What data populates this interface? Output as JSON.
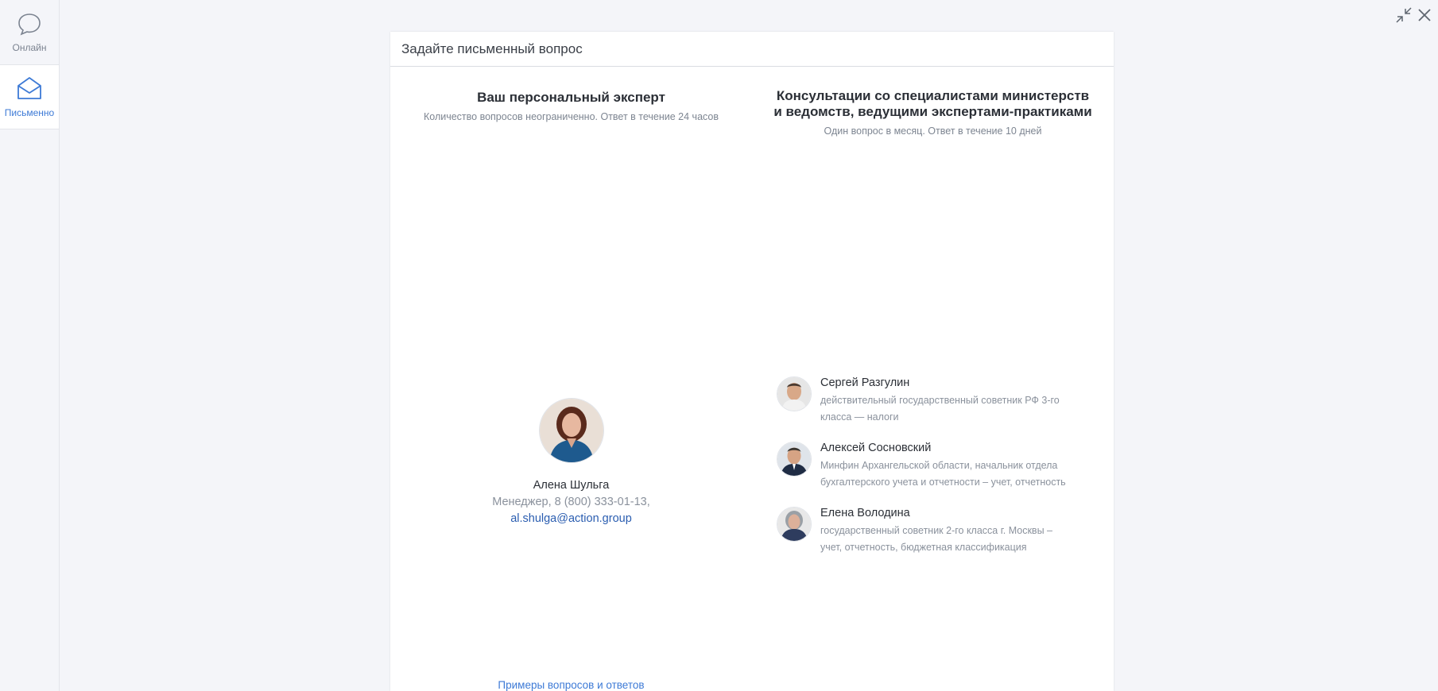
{
  "sidebar": {
    "items": [
      {
        "label": "Онлайн",
        "icon": "chat-bubble-icon",
        "active": false
      },
      {
        "label": "Письменно",
        "icon": "envelope-icon",
        "active": true
      }
    ]
  },
  "window_controls": {
    "minimize_icon": "collapse-icon",
    "close_icon": "close-icon"
  },
  "panel": {
    "title": "Задайте письменный вопрос"
  },
  "personal": {
    "title": "Ваш персональный эксперт",
    "subtitle": "Количество вопросов неограниченно. Ответ в течение 24 часов",
    "expert": {
      "name": "Алена Шульга",
      "role": "Менеджер, 8 (800) 333-01-13,",
      "email": "al.shulga@action.group"
    },
    "examples_link": "Примеры вопросов и ответов"
  },
  "consultations": {
    "title_line1": "Консультации со специалистами министерств",
    "title_line2": "и ведомств, ведущими экспертами-практиками",
    "subtitle": "Один вопрос в месяц. Ответ в течение 10 дней",
    "experts": [
      {
        "name": "Сергей Разгулин",
        "desc": "действительный государственный советник РФ 3-го класса — налоги"
      },
      {
        "name": "Алексей Сосновский",
        "desc": "Минфин Архангельской области, начальник отдела бухгалтерского учета и отчетности – учет, отчетность"
      },
      {
        "name": "Елена Володина",
        "desc": "государственный советник 2-го класса г. Москвы – учет, отчетность, бюджетная классификация"
      }
    ]
  },
  "colors": {
    "accent": "#3d7ad6",
    "link": "#2a5db0",
    "muted": "#8a919c",
    "background": "#f4f5f9"
  }
}
